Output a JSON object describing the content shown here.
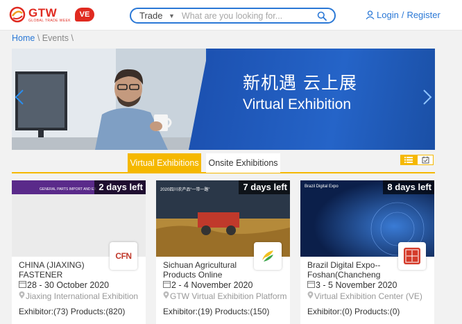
{
  "header": {
    "logo_text": "GTW",
    "logo_subtext": "GLOBAL TRADE WEEK",
    "ve_badge": "VE",
    "search": {
      "category": "Trade",
      "placeholder": "What are you looking for..."
    },
    "login_label": "Login",
    "separator": "/",
    "register_label": "Register"
  },
  "breadcrumb": {
    "home": "Home",
    "sep1": " \\ ",
    "current": "Events",
    "sep2": " \\"
  },
  "banner": {
    "title_cn": "新机遇  云上展",
    "title_en": "Virtual Exhibition",
    "prev_icon": "chevron-left-icon",
    "next_icon": "chevron-right-icon"
  },
  "tabs": [
    {
      "label": "Virtual Exhibitions",
      "active": true
    },
    {
      "label": "Onsite Exhibitions",
      "active": false
    }
  ],
  "view_toggle": {
    "list_icon": "list-view-icon",
    "calendar_icon": "calendar-view-icon"
  },
  "colors": {
    "accent_blue": "#2a78d6",
    "accent_yellow": "#f5b800",
    "brand_red": "#e02a20"
  },
  "cards": [
    {
      "days_left": "2 days left",
      "title": "CHINA (JIAXING) FASTENER",
      "date": "28 - 30 October 2020",
      "venue": "Jiaxing International Exhibition",
      "stats": "Exhibitor:(73) Products:(820)",
      "logo_text": "CFN",
      "image_caption": "GENERAL PARTS IMPORT AND EX"
    },
    {
      "days_left": "7 days left",
      "title": "Sichuan Agricultural Products Online",
      "date": "2 - 4 November 2020",
      "venue": "GTW Virtual Exhibition Platform",
      "stats": "Exhibitor:(19) Products:(150)",
      "image_caption": "2020四川农产品“一带一路”"
    },
    {
      "days_left": "8 days left",
      "title": "Brazil Digital Expo--Foshan(Chancheng",
      "date": "3 - 5 November 2020",
      "venue": "Virtual Exhibition Center (VE)",
      "stats": "Exhibitor:(0) Products:(0)",
      "image_caption": "Brazil Digital Expo"
    }
  ]
}
